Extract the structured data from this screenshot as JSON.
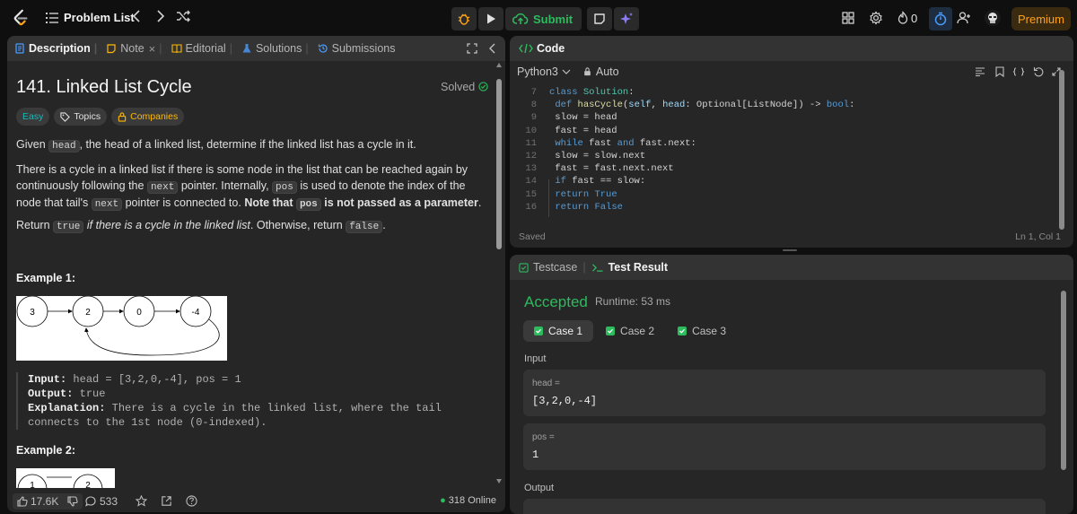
{
  "topbar": {
    "problem_list_label": "Problem List",
    "submit_label": "Submit",
    "streak_count": "0",
    "premium_label": "Premium"
  },
  "left_tabs": [
    {
      "label": "Description",
      "icon": "document-icon"
    },
    {
      "label": "Note",
      "icon": "note-icon"
    },
    {
      "label": "Editorial",
      "icon": "book-icon"
    },
    {
      "label": "Solutions",
      "icon": "flask-icon"
    },
    {
      "label": "Submissions",
      "icon": "history-icon"
    }
  ],
  "problem": {
    "title": "141. Linked List Cycle",
    "status": "Solved",
    "difficulty": "Easy",
    "topics_label": "Topics",
    "companies_label": "Companies",
    "p1_pre": "Given ",
    "p1_code": "head",
    "p1_post": ", the head of a linked list, determine if the linked list has a cycle in it.",
    "p2_a": "There is a cycle in a linked list if there is some node in the list that can be reached again by continuously following the ",
    "p2_code1": "next",
    "p2_b": " pointer. Internally, ",
    "p2_code2": "pos",
    "p2_c": " is used to denote the index of the node that tail's ",
    "p2_code3": "next",
    "p2_d": " pointer is connected to. ",
    "p2_bold1": "Note that ",
    "p2_code4": "pos",
    "p2_bold2": " is not passed as a parameter",
    "p2_end": ".",
    "p3_pre": "Return ",
    "p3_code1": "true",
    "p3_mid": " if there is a cycle in the linked list",
    "p3_mid2": ". Otherwise, return ",
    "p3_code2": "false",
    "p3_end": "."
  },
  "example1": {
    "heading": "Example 1:",
    "nodes": [
      "3",
      "2",
      "0",
      "-4"
    ],
    "input_label": "Input:",
    "input_value": " head = [3,2,0,-4], pos = 1",
    "output_label": "Output:",
    "output_value": " true",
    "explanation_label": "Explanation:",
    "explanation_value": " There is a cycle in the linked list, where the tail connects to the 1st node (0-indexed)."
  },
  "example2": {
    "heading": "Example 2:",
    "nodes": [
      "1",
      "2"
    ]
  },
  "left_footer": {
    "likes": "17.6K",
    "comments": "533",
    "online": "318 Online"
  },
  "code_panel": {
    "header": "Code",
    "language": "Python3",
    "auto_label": "Auto",
    "saved": "Saved",
    "cursor": "Ln 1, Col 1",
    "lines": [
      {
        "n": "7"
      },
      {
        "n": "8"
      },
      {
        "n": "9"
      },
      {
        "n": "10"
      },
      {
        "n": "11"
      },
      {
        "n": "12"
      },
      {
        "n": "13"
      },
      {
        "n": "14"
      },
      {
        "n": "15"
      },
      {
        "n": "16"
      }
    ]
  },
  "test_panel": {
    "tab_testcase": "Testcase",
    "tab_result": "Test Result",
    "verdict": "Accepted",
    "runtime": "Runtime: 53 ms",
    "cases": [
      "Case 1",
      "Case 2",
      "Case 3"
    ],
    "input_label": "Input",
    "head_key": "head =",
    "head_value": "[3,2,0,-4]",
    "pos_key": "pos =",
    "pos_value": "1",
    "output_label": "Output"
  },
  "colors": {
    "accent_green": "#2cbb5d",
    "premium": "#ffa116",
    "easy": "#1cb8b8"
  }
}
